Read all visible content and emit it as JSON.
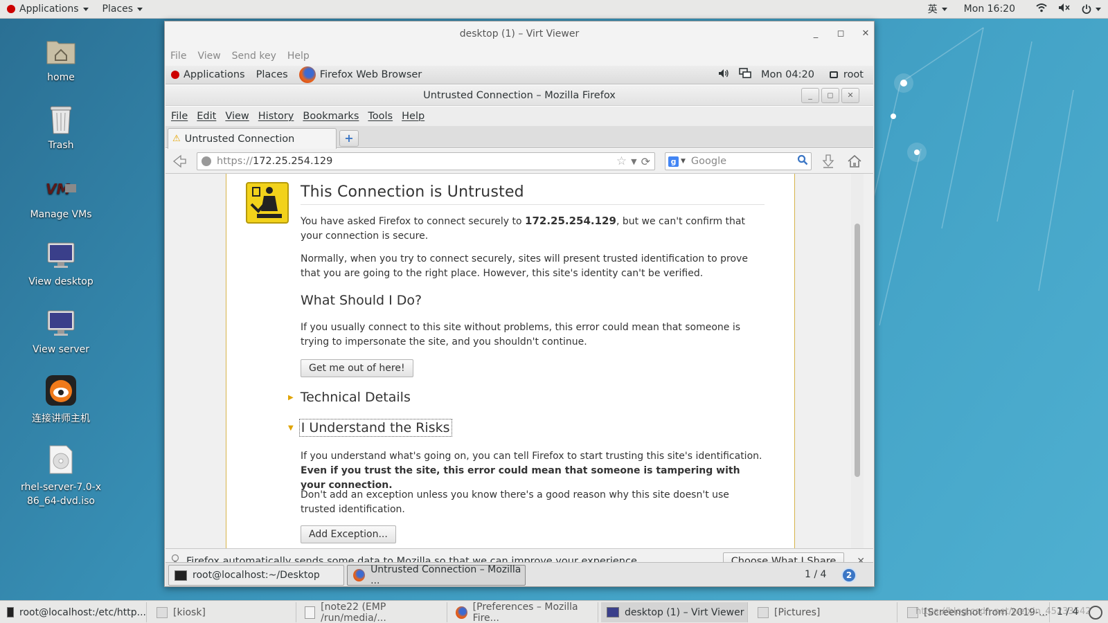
{
  "top_panel": {
    "applications": "Applications",
    "places": "Places",
    "lang": "英",
    "clock": "Mon 16:20"
  },
  "desktop_icons": [
    {
      "label": "home"
    },
    {
      "label": "Trash"
    },
    {
      "label": "Manage VMs"
    },
    {
      "label": "View desktop"
    },
    {
      "label": "View server"
    },
    {
      "label": "连接讲师主机"
    },
    {
      "label": "rhel-server-7.0-x86_64-dvd.iso"
    }
  ],
  "viewer": {
    "title": "desktop (1) – Virt Viewer",
    "menu": [
      "File",
      "View",
      "Send key",
      "Help"
    ]
  },
  "guest_panel": {
    "applications": "Applications",
    "places": "Places",
    "active_app": "Firefox Web Browser",
    "clock": "Mon 04:20",
    "user": "root"
  },
  "firefox": {
    "title": "Untrusted Connection – Mozilla Firefox",
    "menu": [
      "File",
      "Edit",
      "View",
      "History",
      "Bookmarks",
      "Tools",
      "Help"
    ],
    "tab_label": "Untrusted Connection",
    "url_scheme": "https://",
    "url_host": "172.25.254.129",
    "search_placeholder": "Google",
    "notification": "Firefox automatically sends some data to Mozilla so that we can improve your experience.",
    "notification_button": "Choose What I Share"
  },
  "error_page": {
    "title": "This Connection is Untrusted",
    "intro_pre": "You have asked Firefox to connect securely to ",
    "intro_host": "172.25.254.129",
    "intro_post": ", but we can't confirm that your connection is secure.",
    "normally": "Normally, when you try to connect securely, sites will present trusted identification to prove that you are going to the right place. However, this site's identity can't be verified.",
    "what_title": "What Should I Do?",
    "what_text": "If you usually connect to this site without problems, this error could mean that someone is trying to impersonate the site, and you shouldn't continue.",
    "get_out": "Get me out of here!",
    "technical": "Technical Details",
    "risks": "I Understand the Risks",
    "risks_pre": "If you understand what's going on, you can tell Firefox to start trusting this site's identification. ",
    "risks_bold": "Even if you trust the site, this error could mean that someone is tampering with your connection.",
    "dont_add": "Don't add an exception unless you know there's a good reason why this site doesn't use trusted identification.",
    "add_exception": "Add Exception..."
  },
  "guest_taskbar": {
    "items": [
      "root@localhost:~/Desktop",
      "Untrusted Connection – Mozilla ..."
    ],
    "pager": "1 / 4",
    "badge": "2"
  },
  "host_taskbar": {
    "items": [
      "root@localhost:/etc/http...",
      "[kiosk]",
      "[note22 (EMP /run/media/...",
      "[Preferences – Mozilla Fire...",
      "desktop (1) – Virt Viewer",
      "[Pictures]",
      "[Screenshot from 2019-..."
    ],
    "pager": "1 / 4",
    "watermark": "https://blog.csdn.net/weixin_45233542"
  },
  "colors": {
    "warning_border": "#d6b348",
    "desktop": "#3b8fb4",
    "accent_blue": "#3b76c5"
  }
}
